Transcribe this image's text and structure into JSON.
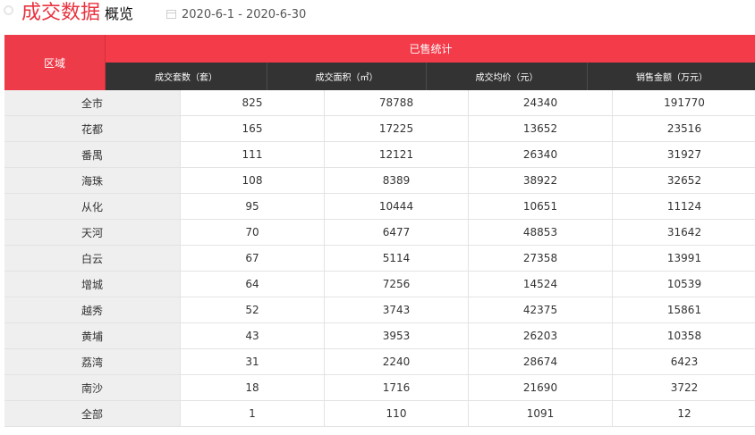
{
  "header": {
    "title_main": "成交数据",
    "title_sub": "概览",
    "date_range": "2020-6-1 - 2020-6-30"
  },
  "table": {
    "region_header": "区域",
    "group_header": "已售统计",
    "columns": [
      "成交套数（套）",
      "成交面积（㎡）",
      "成交均价（元）",
      "销售金额（万元）"
    ],
    "rows": [
      {
        "region": "全市",
        "units": "825",
        "area": "78788",
        "avg_price": "24340",
        "amount": "191770"
      },
      {
        "region": "花都",
        "units": "165",
        "area": "17225",
        "avg_price": "13652",
        "amount": "23516"
      },
      {
        "region": "番禺",
        "units": "111",
        "area": "12121",
        "avg_price": "26340",
        "amount": "31927"
      },
      {
        "region": "海珠",
        "units": "108",
        "area": "8389",
        "avg_price": "38922",
        "amount": "32652"
      },
      {
        "region": "从化",
        "units": "95",
        "area": "10444",
        "avg_price": "10651",
        "amount": "11124"
      },
      {
        "region": "天河",
        "units": "70",
        "area": "6477",
        "avg_price": "48853",
        "amount": "31642"
      },
      {
        "region": "白云",
        "units": "67",
        "area": "5114",
        "avg_price": "27358",
        "amount": "13991"
      },
      {
        "region": "增城",
        "units": "64",
        "area": "7256",
        "avg_price": "14524",
        "amount": "10539"
      },
      {
        "region": "越秀",
        "units": "52",
        "area": "3743",
        "avg_price": "42375",
        "amount": "15861"
      },
      {
        "region": "黄埔",
        "units": "43",
        "area": "3953",
        "avg_price": "26203",
        "amount": "10358"
      },
      {
        "region": "荔湾",
        "units": "31",
        "area": "2240",
        "avg_price": "28674",
        "amount": "6423"
      },
      {
        "region": "南沙",
        "units": "18",
        "area": "1716",
        "avg_price": "21690",
        "amount": "3722"
      },
      {
        "region": "全部",
        "units": "1",
        "area": "110",
        "avg_price": "1091",
        "amount": "12"
      }
    ]
  }
}
